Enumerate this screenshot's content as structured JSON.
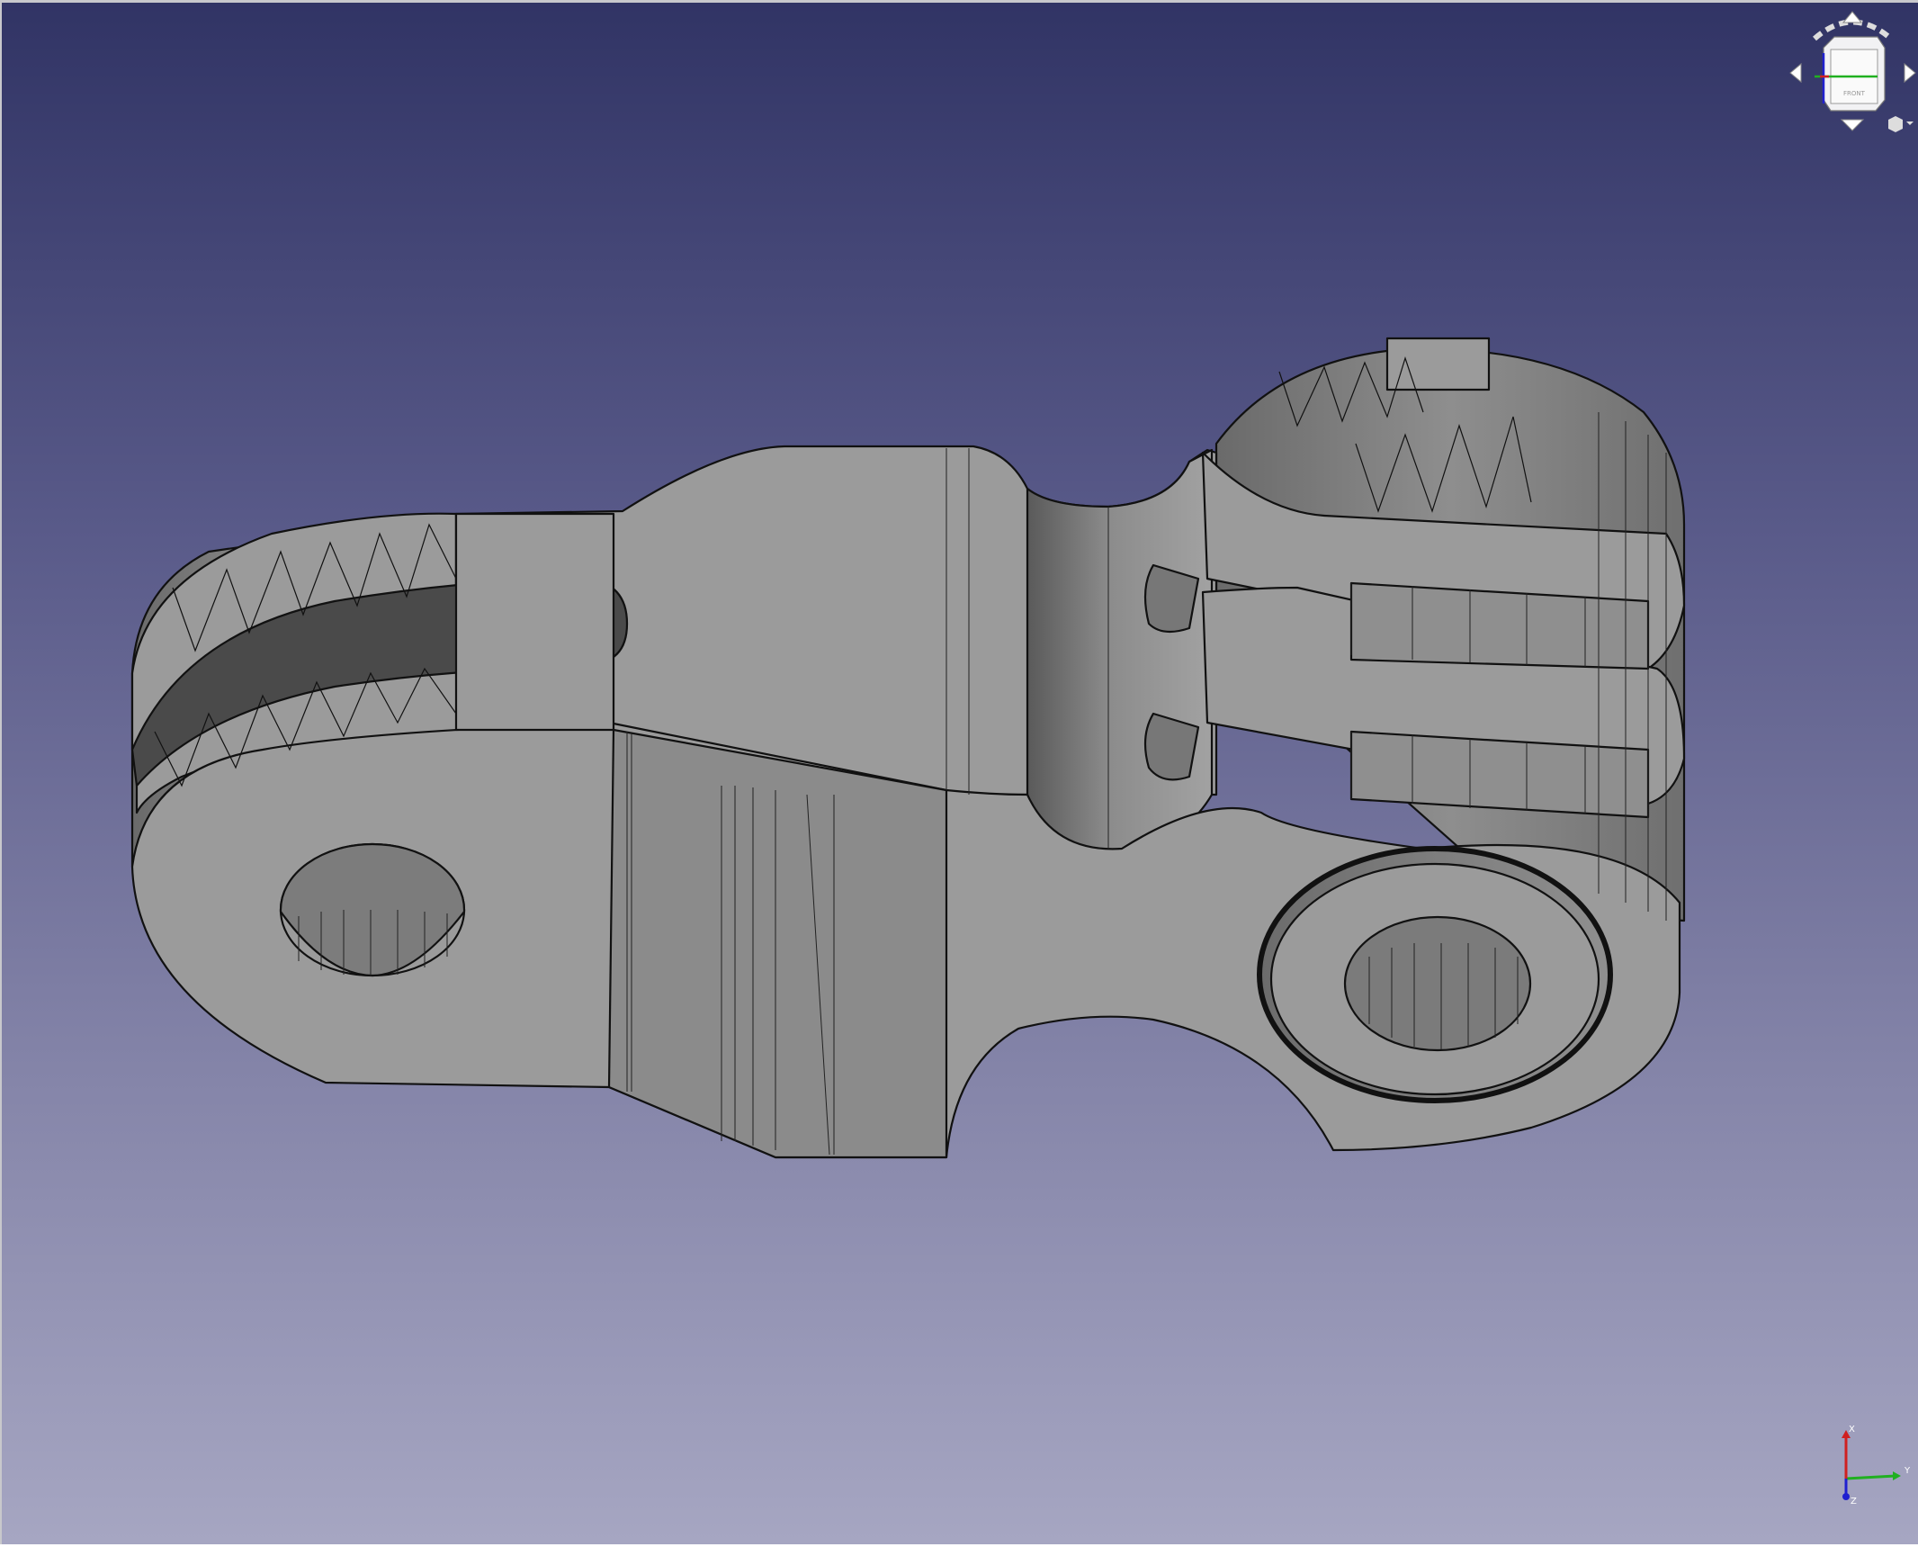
{
  "viewport": {
    "background_top": "#313465",
    "background_bottom": "#a6a6c2",
    "model_color": "#9b9b9b",
    "edge_color": "#111111"
  },
  "navcube": {
    "face_label": "FRONT"
  },
  "axis_cross": {
    "x_label": "X",
    "y_label": "Y",
    "z_label": "Z",
    "x_color": "#d02020",
    "y_color": "#20b020",
    "z_color": "#2020d0"
  }
}
